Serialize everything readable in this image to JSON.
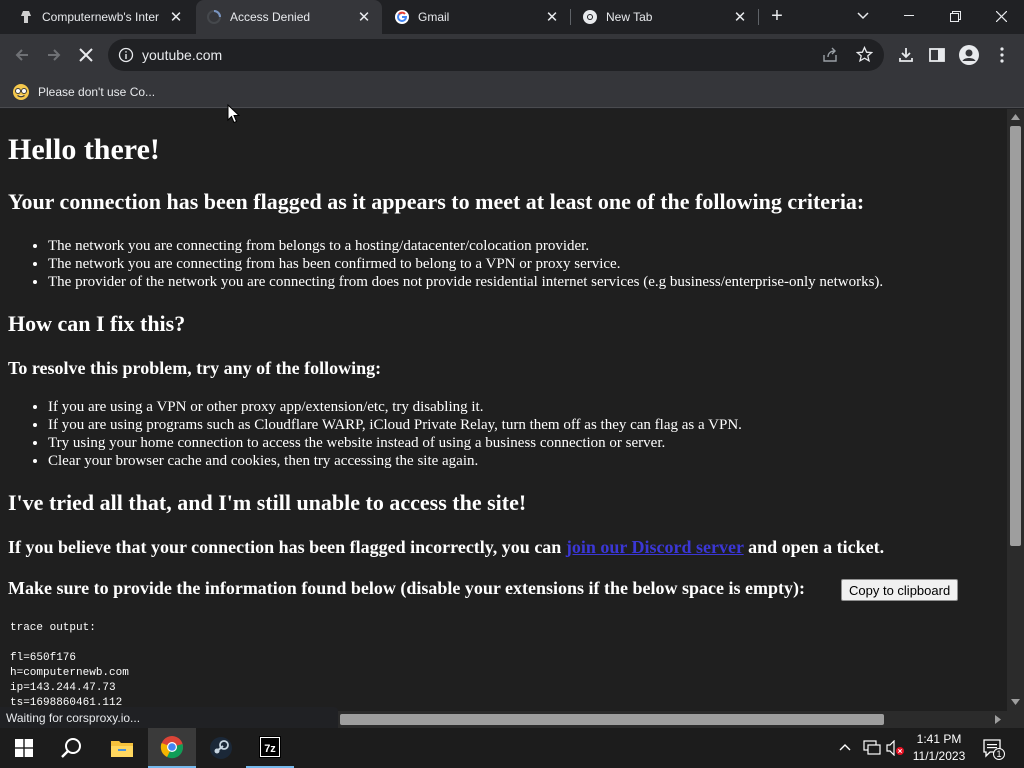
{
  "tabs": [
    {
      "title": "Computernewb's Inter",
      "active": false,
      "icon": "computernewb-favicon"
    },
    {
      "title": "Access Denied",
      "active": true,
      "icon": "loading-spinner-icon"
    },
    {
      "title": "Gmail",
      "active": false,
      "icon": "google-icon"
    },
    {
      "title": "New Tab",
      "active": false,
      "icon": "chrome-icon"
    }
  ],
  "address_bar": {
    "url": "youtube.com"
  },
  "bookmarks": [
    {
      "label": "Please don't use Co...",
      "icon": "nerd-emoji-icon"
    }
  ],
  "page": {
    "heading": "Hello there!",
    "flagged_heading": "Your connection has been flagged as it appears to meet at least one of the following criteria:",
    "criteria": [
      "The network you are connecting from belongs to a hosting/datacenter/colocation provider.",
      "The network you are connecting from has been confirmed to belong to a VPN or proxy service.",
      "The provider of the network you are connecting from does not provide residential internet services (e.g business/enterprise-only networks)."
    ],
    "fix_heading": "How can I fix this?",
    "resolve_heading": "To resolve this problem, try any of the following:",
    "fixes": [
      "If you are using a VPN or other proxy app/extension/etc, try disabling it.",
      "If you are using programs such as Cloudflare WARP, iCloud Private Relay, turn them off as they can flag as a VPN.",
      "Try using your home connection to access the website instead of using a business connection or server.",
      "Clear your browser cache and cookies, then try accessing the site again."
    ],
    "tried_heading": "I've tried all that, and I'm still unable to access the site!",
    "incorrect_prefix": "If you believe that your connection has been flagged incorrectly, you can ",
    "discord_link": "join our Discord server",
    "incorrect_suffix": " and open a ticket.",
    "provide_info": "Make sure to provide the information found below (disable your extensions if the below space is empty):",
    "copy_button": "Copy to clipboard",
    "trace_label": "trace output:",
    "trace_lines": [
      "fl=650f176",
      "h=computernewb.com",
      "ip=143.244.47.73",
      "ts=1698860461.112"
    ]
  },
  "status_bar": {
    "text": "Waiting for corsproxy.io..."
  },
  "taskbar": {
    "apps": [
      "windows-start-icon",
      "search-icon",
      "file-explorer-icon",
      "chrome-icon",
      "steam-icon",
      "7zip-icon"
    ],
    "time": "1:41 PM",
    "date": "11/1/2023",
    "notification_count": "1"
  }
}
